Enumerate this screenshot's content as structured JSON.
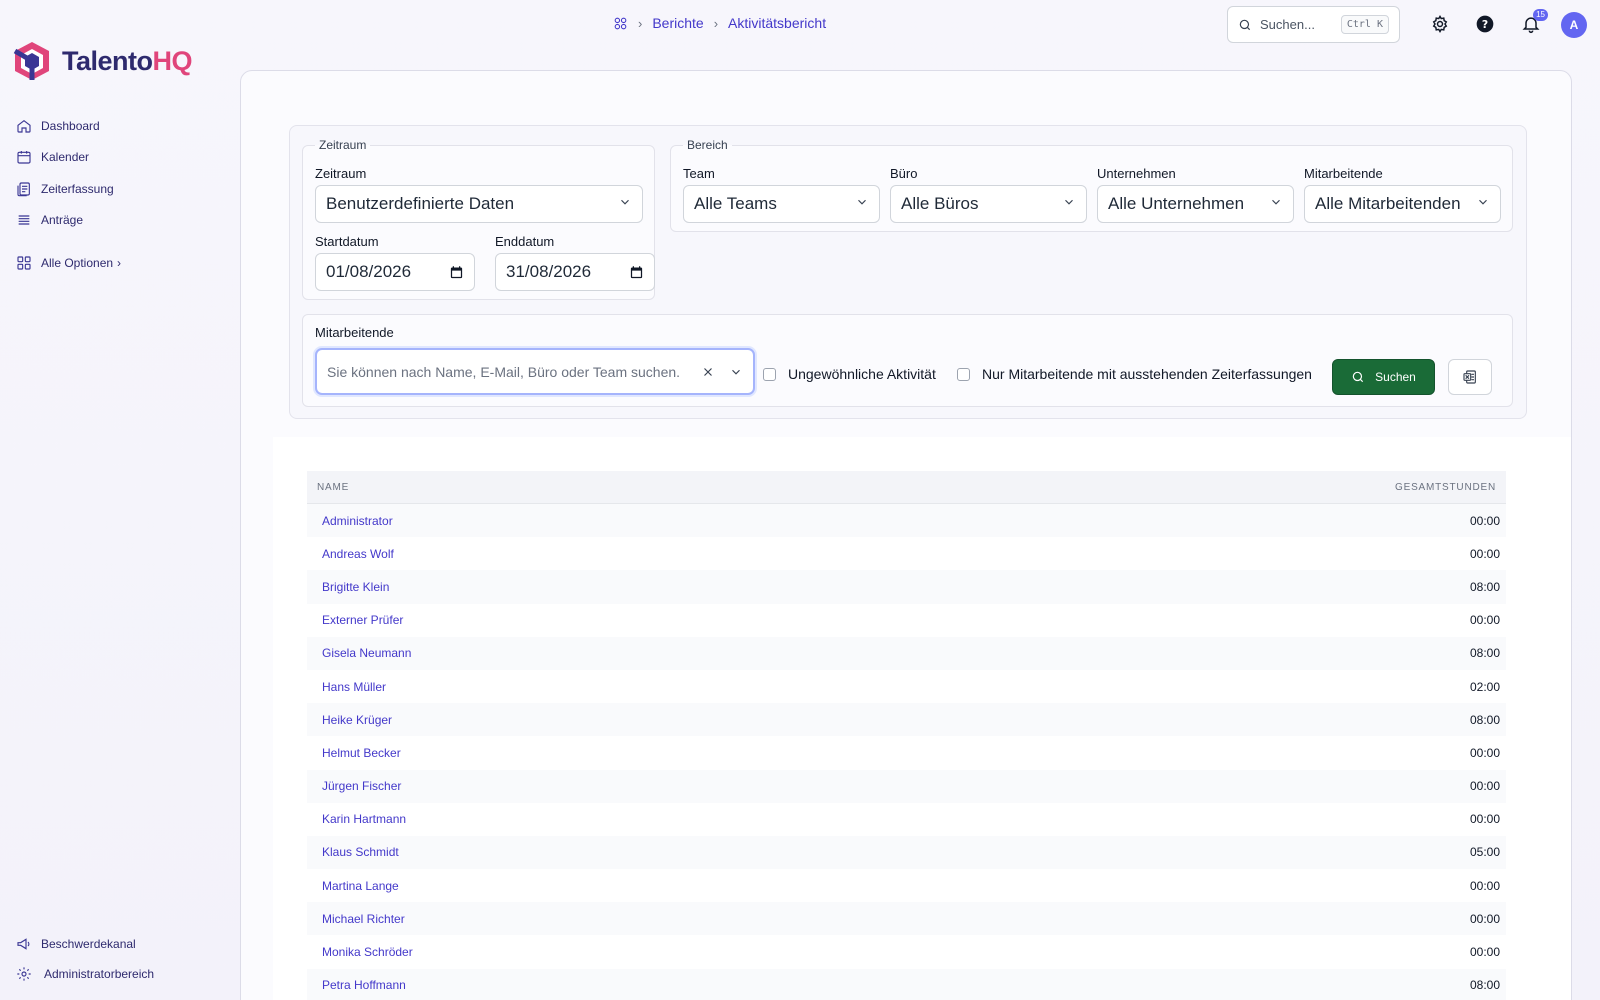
{
  "app": {
    "logo_main": "Talento",
    "logo_accent": "HQ"
  },
  "sidebar": {
    "items": [
      {
        "label": "Dashboard",
        "icon": "home-icon"
      },
      {
        "label": "Kalender",
        "icon": "calendar-icon"
      },
      {
        "label": "Zeiterfassung",
        "icon": "timesheet-icon"
      },
      {
        "label": "Anträge",
        "icon": "list-icon"
      }
    ],
    "all_options": "Alle Optionen",
    "bottom": [
      {
        "label": "Beschwerdekanal",
        "icon": "megaphone-icon"
      },
      {
        "label": "Administratorbereich",
        "icon": "gear-icon"
      }
    ]
  },
  "breadcrumb": {
    "items": [
      "Berichte",
      "Aktivitätsbericht"
    ]
  },
  "topbar": {
    "search_placeholder": "Suchen...",
    "search_shortcut": "Ctrl K",
    "notification_count": "15",
    "avatar_initial": "A"
  },
  "filters": {
    "zeitraum_legend": "Zeitraum",
    "zeitraum_label": "Zeitraum",
    "zeitraum_value": "Benutzerdefinierte Daten",
    "start_label": "Startdatum",
    "start_value": "01/08/2026",
    "end_label": "Enddatum",
    "end_value": "31/08/2026",
    "bereich_legend": "Bereich",
    "team_label": "Team",
    "team_value": "Alle Teams",
    "buero_label": "Büro",
    "buero_value": "Alle Büros",
    "unternehmen_label": "Unternehmen",
    "unternehmen_value": "Alle Unternehmen",
    "mitarbeitende_label": "Mitarbeitende",
    "mitarbeitende_value": "Alle Mitarbeitenden",
    "employee_search_label": "Mitarbeitende",
    "employee_search_placeholder": "Sie können nach Name, E-Mail, Büro oder Team suchen.",
    "unusual_activity": "Ungewöhnliche Aktivität",
    "pending_only": "Nur Mitarbeitende mit ausstehenden Zeiterfassungen",
    "search_button": "Suchen"
  },
  "table": {
    "headers": {
      "name": "NAME",
      "hours": "GESAMTSTUNDEN"
    },
    "rows": [
      {
        "name": "Administrator",
        "hours": "00:00"
      },
      {
        "name": "Andreas Wolf",
        "hours": "00:00"
      },
      {
        "name": "Brigitte Klein",
        "hours": "08:00"
      },
      {
        "name": "Externer Prüfer",
        "hours": "00:00"
      },
      {
        "name": "Gisela Neumann",
        "hours": "08:00"
      },
      {
        "name": "Hans Müller",
        "hours": "02:00"
      },
      {
        "name": "Heike Krüger",
        "hours": "08:00"
      },
      {
        "name": "Helmut Becker",
        "hours": "00:00"
      },
      {
        "name": "Jürgen Fischer",
        "hours": "00:00"
      },
      {
        "name": "Karin Hartmann",
        "hours": "00:00"
      },
      {
        "name": "Klaus Schmidt",
        "hours": "05:00"
      },
      {
        "name": "Martina Lange",
        "hours": "00:00"
      },
      {
        "name": "Michael Richter",
        "hours": "00:00"
      },
      {
        "name": "Monika Schröder",
        "hours": "00:00"
      },
      {
        "name": "Petra Hoffmann",
        "hours": "08:00"
      }
    ]
  },
  "colors": {
    "brand": "#2e2a6e",
    "accent": "#e0457b",
    "link": "#4338ca",
    "primary_button": "#1a6b37"
  }
}
